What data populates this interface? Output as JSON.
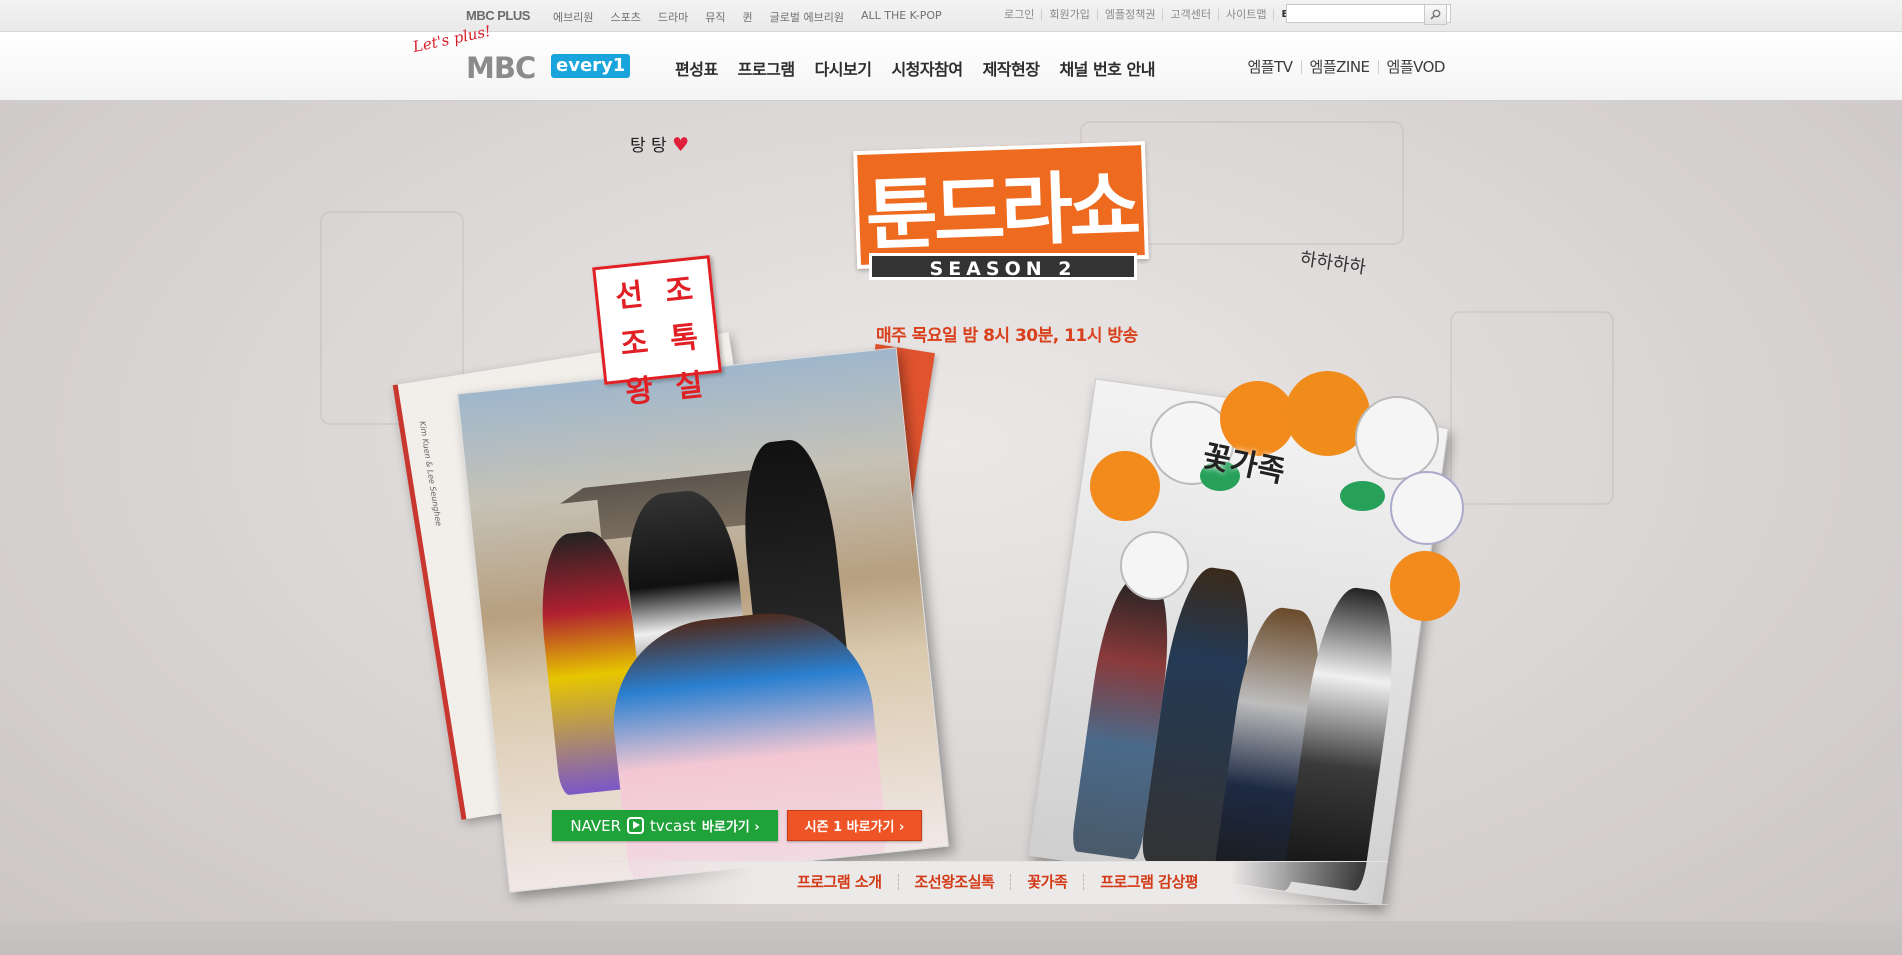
{
  "topbar": {
    "brand": "MBC PLUS",
    "channels": [
      "에브리원",
      "스포츠",
      "드라마",
      "뮤직",
      "퀸",
      "글로벌 에브리원",
      "ALL THE K-POP"
    ],
    "utils": [
      "로그인",
      "회원가입",
      "엠플정책권",
      "고객센터",
      "사이트맵",
      "ENG"
    ],
    "search_placeholder": ""
  },
  "gnb": {
    "logo_tagline": "Let's plus!",
    "logo_mbc": "MBC",
    "logo_every": "every1",
    "menu": [
      "편성표",
      "프로그램",
      "다시보기",
      "시청자참여",
      "제작현장",
      "채널 번호 안내"
    ],
    "sub_menu": [
      "엠플TV",
      "엠플ZINE",
      "엠플VOD"
    ]
  },
  "hero": {
    "title": "툰드라쇼",
    "season": "SEASON 2",
    "airtime": "매주 목요일 밤 8시 30분, 11시 방송",
    "left_show_chars": [
      "선",
      "조",
      "조",
      "톡",
      "왕",
      "실"
    ],
    "left_show_label": "조선왕조실톡",
    "left_caption": "탕 탕",
    "right_show_label": "꽃가족",
    "right_caption": "하하하하",
    "book_spine": "Kim Kuen & Lee Seunghee"
  },
  "buttons": {
    "naver_brand": "NAVER",
    "naver_tvcast": "tvcast",
    "naver_go": "바로가기 ›",
    "season1": "시즌 1 바로가기 ›"
  },
  "bottom_nav": [
    "프로그램 소개",
    "조선왕조실톡",
    "꽃가족",
    "프로그램 감상평"
  ],
  "colors": {
    "accent_orange": "#ee6a1f",
    "naver_green": "#1fa23a",
    "season_button": "#ee5426",
    "bottom_nav_text": "#d33a18",
    "every_blue": "#1aa4dc"
  }
}
